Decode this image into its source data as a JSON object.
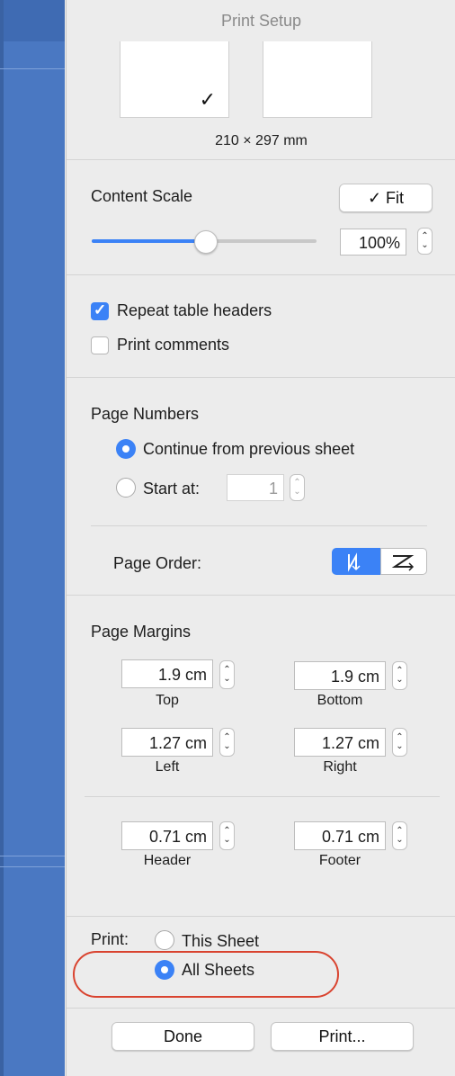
{
  "title": "Print Setup",
  "paper_size": "210 × 297 mm",
  "paper_selected_mark": "✓",
  "content_scale": {
    "label": "Content Scale",
    "fit_button": "✓ Fit",
    "value": "100%",
    "slider_level_fraction": 0.5
  },
  "options": {
    "repeat_headers": {
      "label": "Repeat table headers",
      "checked": true
    },
    "print_comments": {
      "label": "Print comments",
      "checked": false
    }
  },
  "page_numbers": {
    "heading": "Page Numbers",
    "continue_label": "Continue from previous sheet",
    "start_label": "Start at:",
    "start_value": "1"
  },
  "page_order": {
    "label": "Page Order:"
  },
  "margins": {
    "heading": "Page Margins",
    "top": {
      "value": "1.9 cm",
      "label": "Top"
    },
    "bottom": {
      "value": "1.9 cm",
      "label": "Bottom"
    },
    "left": {
      "value": "1.27 cm",
      "label": "Left"
    },
    "right": {
      "value": "1.27 cm",
      "label": "Right"
    },
    "header": {
      "value": "0.71 cm",
      "label": "Header"
    },
    "footer": {
      "value": "0.71 cm",
      "label": "Footer"
    }
  },
  "print_scope": {
    "label": "Print:",
    "this_sheet": "This Sheet",
    "all_sheets": "All Sheets",
    "selected": "All Sheets"
  },
  "buttons": {
    "done": "Done",
    "print": "Print..."
  },
  "colors": {
    "accent": "#3b82f6",
    "sidebar": "#4a78c2",
    "highlight": "#d9432f"
  }
}
